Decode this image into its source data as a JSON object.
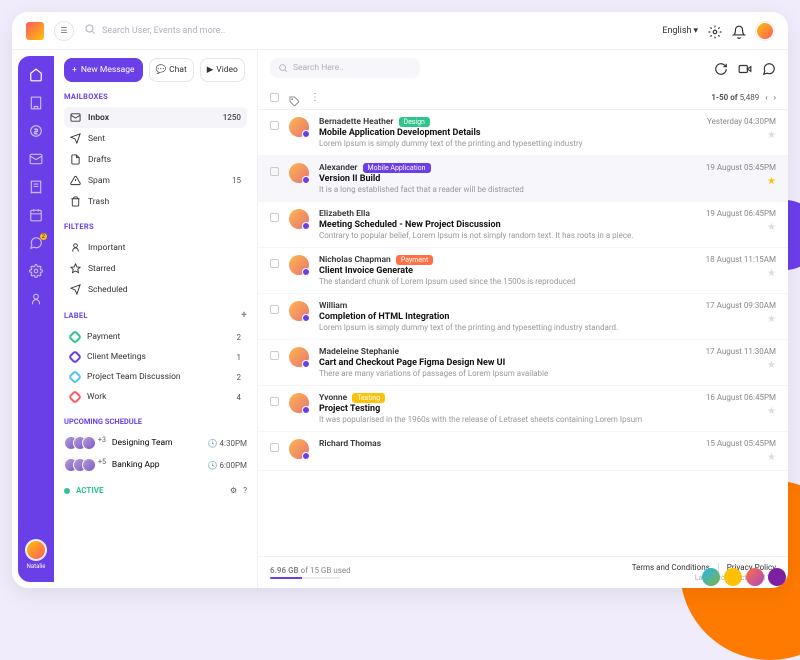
{
  "topbar": {
    "search_placeholder": "Search User, Events and more..",
    "language": "English"
  },
  "rail": {
    "items": [
      {
        "name": "home-icon"
      },
      {
        "name": "buildings-icon"
      },
      {
        "name": "dollar-icon"
      },
      {
        "name": "mail-icon"
      },
      {
        "name": "receipt-icon"
      },
      {
        "name": "calendar-icon"
      },
      {
        "name": "chat-icon",
        "badge": "2"
      },
      {
        "name": "settings-icon"
      },
      {
        "name": "user-icon"
      }
    ],
    "user_name": "Natalie"
  },
  "buttons": {
    "new_message": "New Message",
    "chat": "Chat",
    "video": "Video"
  },
  "sections": {
    "mailboxes": "MAILBOXES",
    "filters": "FILTERS",
    "label": "LABEL",
    "schedule": "UPCOMING SCHEDULE",
    "active": "ACTIVE"
  },
  "mailboxes": [
    {
      "label": "Inbox",
      "count": "1250",
      "active": true
    },
    {
      "label": "Sent",
      "count": ""
    },
    {
      "label": "Drafts",
      "count": ""
    },
    {
      "label": "Spam",
      "count": "15"
    },
    {
      "label": "Trash",
      "count": ""
    }
  ],
  "filters": [
    {
      "label": "Important"
    },
    {
      "label": "Starred"
    },
    {
      "label": "Scheduled"
    }
  ],
  "labels": [
    {
      "label": "Payment",
      "count": "2",
      "color": "#30c48d"
    },
    {
      "label": "Client Meetings",
      "count": "1",
      "color": "#6b3fe8"
    },
    {
      "label": "Project Team Discussion",
      "count": "2",
      "color": "#4fc3f7"
    },
    {
      "label": "Work",
      "count": "4",
      "color": "#ff5a5f"
    }
  ],
  "schedule": [
    {
      "title": "Designing Team",
      "plus": "+3",
      "time": "4:30PM"
    },
    {
      "title": "Banking App",
      "plus": "+5",
      "time": "6:00PM"
    }
  ],
  "center": {
    "search_placeholder": "Search Here..",
    "range_prefix": "1-50 of",
    "range_total": "5,489"
  },
  "messages": [
    {
      "from": "Bernadette Heather",
      "tag": "Design",
      "tag_color": "#30c48d",
      "subject": "Mobile Application Development Details",
      "preview": "Lorem Ipsum is simply dummy text of the printing and typesetting industry",
      "date": "Yesterday 04:30PM",
      "starred": false
    },
    {
      "from": "Alexander",
      "tag": "Mobile Application",
      "tag_color": "#6b3fe8",
      "subject": "Version II Build",
      "preview": "It is a long established fact that a reader will be distracted",
      "date": "19 August 05:45PM",
      "starred": true,
      "selected": true
    },
    {
      "from": "Elizabeth Ella",
      "tag": "",
      "subject": "Meeting Scheduled - New Project Discussion",
      "preview": "Contrary to popular belief, Lorem Ipsum is not simply random text. It has roots in a piece.",
      "date": "19 August 06:45PM",
      "starred": false
    },
    {
      "from": "Nicholas Chapman",
      "tag": "Payment",
      "tag_color": "#ff7043",
      "subject": "Client Invoice Generate",
      "preview": "The standard chunk of Lorem Ipsum used since the 1500s is reproduced",
      "date": "18 August 11:15AM",
      "starred": false
    },
    {
      "from": "William",
      "tag": "",
      "subject": "Completion of HTML Integration",
      "preview": "Lorem Ipsum is simply dummy text of the printing and typesetting industry standard.",
      "date": "17 August 09:30AM",
      "starred": false
    },
    {
      "from": "Madeleine Stephanie",
      "tag": "",
      "subject": "Cart and Checkout Page Figma Design New UI",
      "preview": "There are many variations of passages of Lorem Ipsum available",
      "date": "17 August 11:30AM",
      "starred": false
    },
    {
      "from": "Yvonne",
      "tag": "Testing",
      "tag_color": "#ffc107",
      "subject": "Project Testing",
      "preview": "It was popularised in the 1960s with the release of Letraset sheets containing Lorem Ipsum",
      "date": "16 August 06:45PM",
      "starred": false
    },
    {
      "from": "Richard Thomas",
      "tag": "",
      "subject": "",
      "preview": "",
      "date": "15 August 05:45PM",
      "starred": false
    }
  ],
  "footer": {
    "storage_used": "6.96 GB",
    "storage_mid": "of",
    "storage_total": "15 GB used",
    "storage_pct": 46,
    "terms": "Terms and Conditions",
    "privacy": "Privacy Policy",
    "activity_prefix": "Last account activity:",
    "activity_time": "11 h"
  }
}
